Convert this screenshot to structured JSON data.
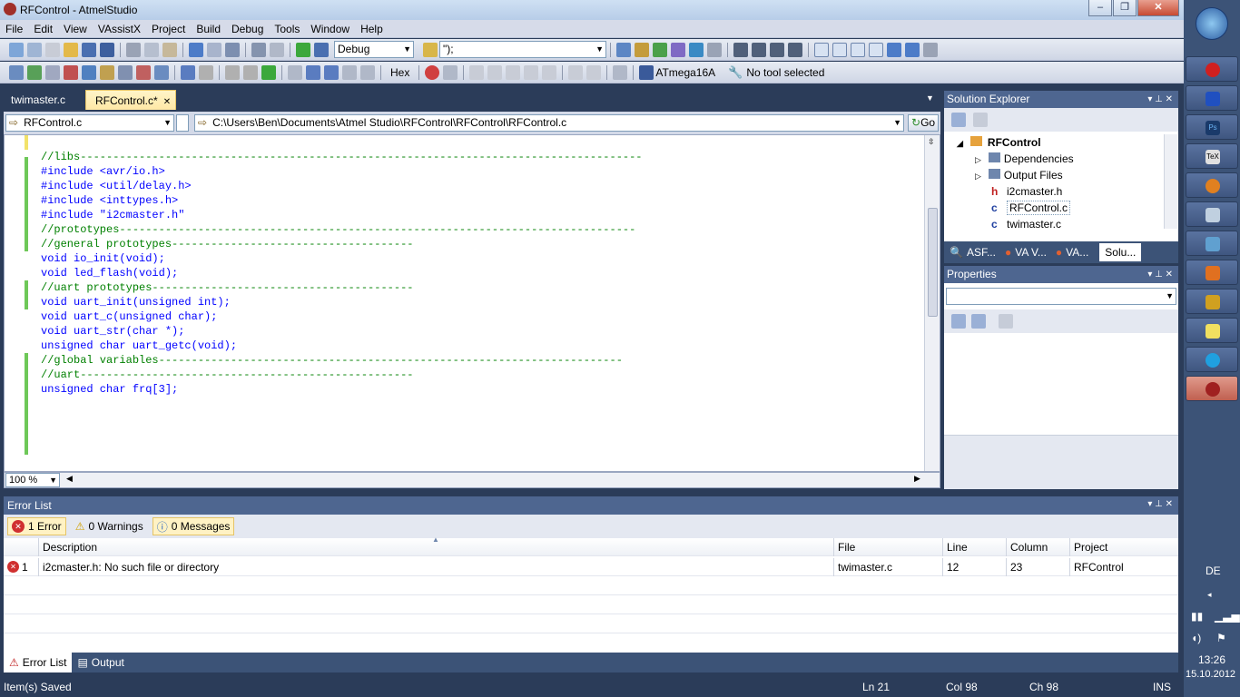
{
  "window": {
    "title": "RFControl - AtmelStudio"
  },
  "menu": [
    "File",
    "Edit",
    "View",
    "VAssistX",
    "Project",
    "Build",
    "Debug",
    "Tools",
    "Window",
    "Help"
  ],
  "toolbar": {
    "config": "Debug",
    "find_combo": "\");",
    "hex_label": "Hex",
    "device": "ATmega16A",
    "tool": "No tool selected"
  },
  "tabs": [
    {
      "label": "twimaster.c"
    },
    {
      "label": "RFControl.c*"
    }
  ],
  "navbar": {
    "file_combo": "RFControl.c",
    "path": "C:\\Users\\Ben\\Documents\\Atmel Studio\\RFControl\\RFControl\\RFControl.c",
    "go": "Go"
  },
  "editor": {
    "zoom": "100 %",
    "lines": [
      {
        "text": "//libs--------------------------------------------------------------------------------------"
      },
      {
        "text": "#include <avr/io.h>"
      },
      {
        "text": "#include <util/delay.h>"
      },
      {
        "text": "#include <inttypes.h>"
      },
      {
        "text": "#include \"i2cmaster.h\""
      },
      {
        "text": ""
      },
      {
        "text": ""
      },
      {
        "text": "//prototypes-------------------------------------------------------------------------------"
      },
      {
        "text": "//general prototypes-------------------------------------"
      },
      {
        "text": "void io_init(void);"
      },
      {
        "text": "void led_flash(void);"
      },
      {
        "text": ""
      },
      {
        "text": "//uart prototypes----------------------------------------"
      },
      {
        "text": "void uart_init(unsigned int);"
      },
      {
        "text": "void uart_c(unsigned char);"
      },
      {
        "text": "void uart_str(char *);"
      },
      {
        "text": "unsigned char uart_getc(void);"
      },
      {
        "text": ""
      },
      {
        "text": "//global variables-----------------------------------------------------------------------"
      },
      {
        "text": "//uart---------------------------------------------------"
      },
      {
        "text": "unsigned char frq[3];"
      }
    ]
  },
  "solution_explorer": {
    "title": "Solution Explorer",
    "project": "RFControl",
    "items": [
      "Dependencies",
      "Output Files",
      "i2cmaster.h",
      "RFControl.c",
      "twimaster.c"
    ],
    "bottom_tabs": [
      "ASF...",
      "VA V...",
      "VA...",
      "Solu..."
    ]
  },
  "properties": {
    "title": "Properties"
  },
  "error_list": {
    "title": "Error List",
    "filters": [
      "1 Error",
      "0 Warnings",
      "0 Messages"
    ],
    "columns": [
      "Description",
      "File",
      "Line",
      "Column",
      "Project"
    ],
    "rows": [
      {
        "num": "1",
        "description": "i2cmaster.h: No such file or directory",
        "file": "twimaster.c",
        "line": "12",
        "column": "23",
        "project": "RFControl"
      }
    ],
    "bottom_tabs": [
      "Error List",
      "Output"
    ]
  },
  "status": {
    "message": "Item(s) Saved",
    "ln": "Ln 21",
    "col": "Col 98",
    "ch": "Ch 98",
    "mode": "INS"
  },
  "taskbar": {
    "lang": "DE",
    "time": "13:26",
    "date": "15.10.2012"
  },
  "colors": {
    "accent": "#2b3c59",
    "comment": "#008000",
    "keyword": "#0000ff",
    "string": "#a31515",
    "active_tab": "#ffe8a6",
    "change_bar": "#6ec858"
  }
}
